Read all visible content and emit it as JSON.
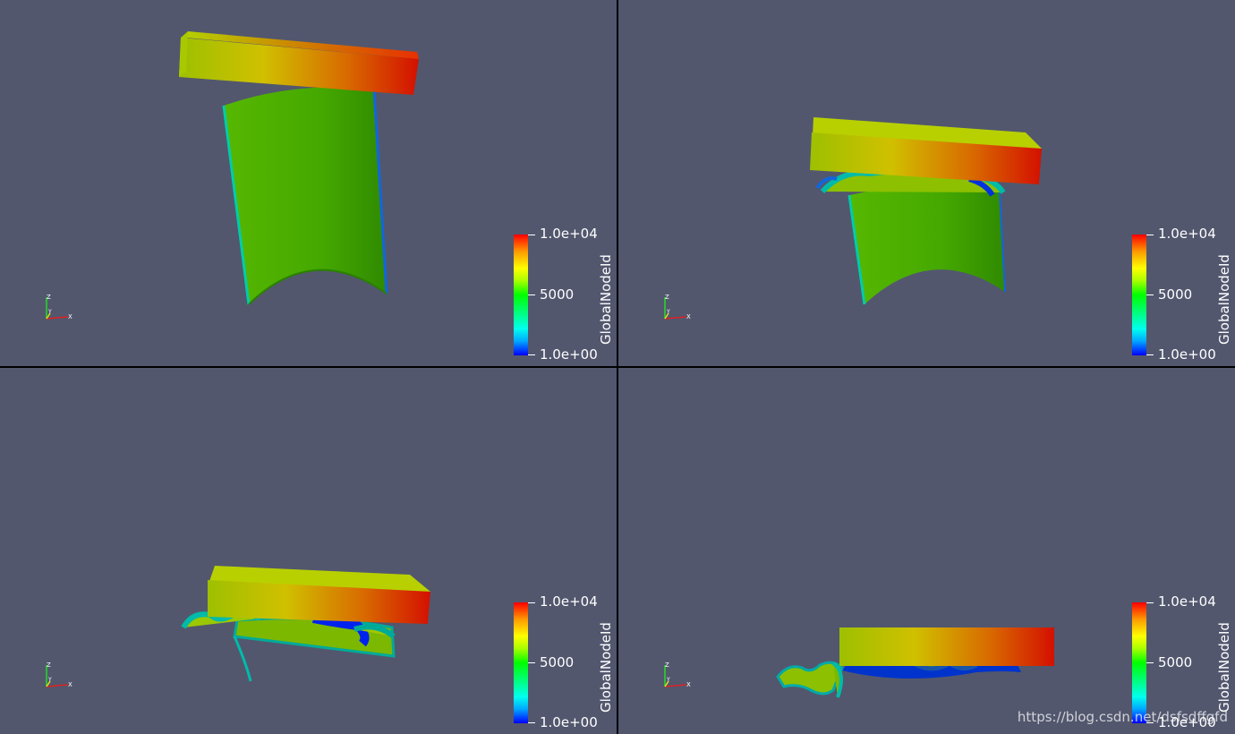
{
  "colorbar": {
    "title": "GlobalNodeId",
    "max_label": "1.0e+04",
    "mid_label": "5000",
    "min_label": "1.0e+00"
  },
  "axes": {
    "x": "X",
    "y": "Y",
    "z": "Z"
  },
  "watermark": "https://blog.csdn.net/dsfsdffgfd",
  "colors": {
    "background": "#52576e",
    "plate_low": "#8db800",
    "plate_high": "#dd1100",
    "tube": "#3fa800",
    "low_id": "#0022dd"
  }
}
